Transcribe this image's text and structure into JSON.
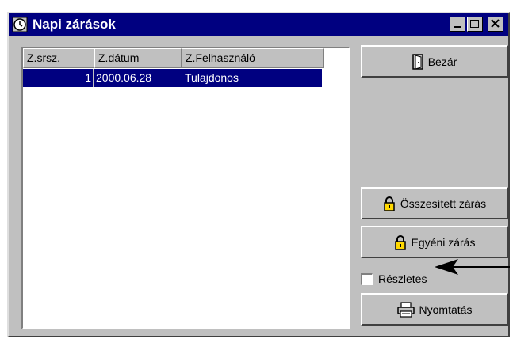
{
  "window": {
    "title": "Napi zárások"
  },
  "list": {
    "columns": [
      "Z.srsz.",
      "Z.dátum",
      "Z.Felhasználó"
    ],
    "rows": [
      {
        "srsz": "1",
        "datum": "2000.06.28",
        "felhasznalo": "Tulajdonos",
        "selected": true
      }
    ]
  },
  "buttons": {
    "close": "Bezár",
    "summary_close": "Összesített zárás",
    "individual_close": "Egyéni zárás",
    "print": "Nyomtatás"
  },
  "detailed": {
    "label": "Részletes",
    "checked": false
  },
  "icons": {
    "app": "clock-icon",
    "close": "door-icon",
    "lock": "padlock-icon",
    "print": "printer-icon",
    "annotation": "arrow-left-icon"
  },
  "colors": {
    "titlebar": "#000080",
    "selection": "#000080",
    "face": "#c0c0c0"
  }
}
